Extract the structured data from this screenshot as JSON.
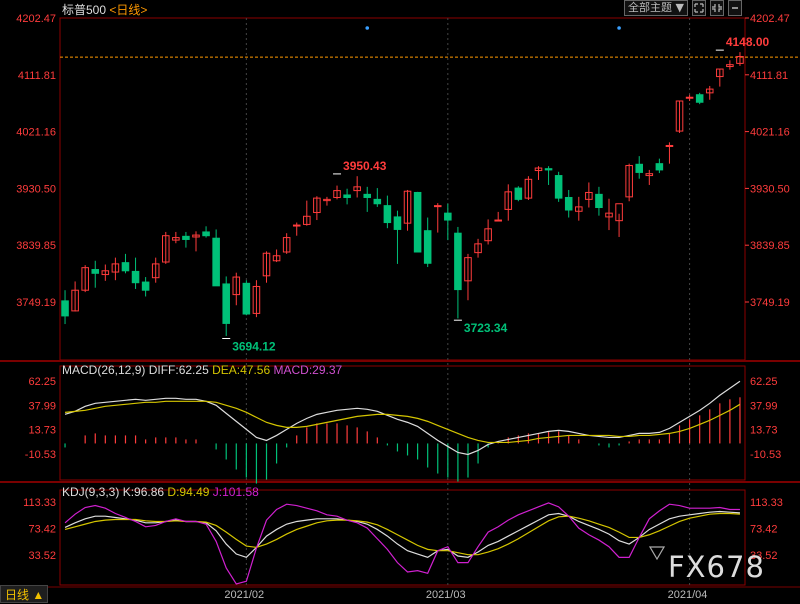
{
  "header": {
    "symbol": "标普500",
    "period_label": "<日线>",
    "theme_label": "全部主题",
    "theme_arrow": "▼",
    "btn_icons": [
      "expand-icon",
      "shrink-icon",
      "minus-icon"
    ]
  },
  "indicators": {
    "macd_name": "MACD(26,12,9)",
    "diff_label": "DIFF:62.25",
    "dea_label": "DEA:47.56",
    "macd_label": "MACD:29.37",
    "kdj_name": "KDJ(9,3,3)",
    "k_label": "K:96.86",
    "d_label": "D:94.49",
    "j_label": "J:101.58"
  },
  "period_button": "日线 ▲",
  "watermark": "FX678",
  "colors": {
    "up": "#ff3c3c",
    "down": "#00c078",
    "axis_price": "#ff3c3c",
    "diff": "#dddddd",
    "dea": "#d4c500",
    "macd_text": "#d050d0",
    "k": "#dddddd",
    "d": "#d4c500",
    "j": "#d020d0",
    "grid": "#8b0000",
    "hline": "#ff9900"
  },
  "chart_data": {
    "type": "candlestick",
    "price_axis": {
      "ticks": [
        "4202.47",
        "4111.81",
        "4021.16",
        "3930.50",
        "3839.85",
        "3749.19"
      ],
      "tick_values": [
        4202.47,
        4111.81,
        4021.16,
        3930.5,
        3839.85,
        3749.19
      ],
      "range": [
        3694.12,
        4202.47
      ]
    },
    "macd_axis": {
      "ticks": [
        "62.25",
        "37.99",
        "13.73",
        "-10.53"
      ],
      "tick_values": [
        62.25,
        37.99,
        13.73,
        -10.53
      ]
    },
    "kdj_axis": {
      "ticks": [
        "113.33",
        "73.42",
        "33.52"
      ],
      "tick_values": [
        113.33,
        73.42,
        33.52
      ]
    },
    "x_labels": [
      "2021/02",
      "2021/03",
      "2021/04"
    ],
    "x_label_bars": [
      18,
      38,
      62
    ],
    "annotations": [
      {
        "text": "3694.12",
        "bar": 16,
        "price": 3694.12,
        "kind": "low"
      },
      {
        "text": "3950.43",
        "bar": 27,
        "price": 3950.43,
        "kind": "high"
      },
      {
        "text": "3723.34",
        "bar": 39,
        "price": 3723.34,
        "kind": "low"
      },
      {
        "text": "4148.00",
        "bar": 65,
        "price": 4148.0,
        "kind": "high"
      }
    ],
    "current_price_line": 4140,
    "ohlc": [
      [
        3751,
        3768,
        3714,
        3727
      ],
      [
        3735,
        3782,
        3734,
        3768
      ],
      [
        3768,
        3808,
        3765,
        3804
      ],
      [
        3801,
        3815,
        3772,
        3795
      ],
      [
        3793,
        3809,
        3783,
        3799
      ],
      [
        3797,
        3820,
        3784,
        3810
      ],
      [
        3812,
        3826,
        3795,
        3799
      ],
      [
        3798,
        3820,
        3770,
        3780
      ],
      [
        3781,
        3789,
        3758,
        3768
      ],
      [
        3788,
        3820,
        3780,
        3810
      ],
      [
        3813,
        3861,
        3810,
        3855
      ],
      [
        3848,
        3861,
        3843,
        3852
      ],
      [
        3854,
        3861,
        3836,
        3849
      ],
      [
        3853,
        3862,
        3830,
        3856
      ],
      [
        3861,
        3870,
        3852,
        3855
      ],
      [
        3851,
        3865,
        3782,
        3775
      ],
      [
        3778,
        3790,
        3695,
        3715
      ],
      [
        3761,
        3796,
        3744,
        3789
      ],
      [
        3779,
        3784,
        3728,
        3730
      ],
      [
        3731,
        3784,
        3725,
        3774
      ],
      [
        3791,
        3830,
        3780,
        3827
      ],
      [
        3815,
        3833,
        3813,
        3823
      ],
      [
        3829,
        3859,
        3826,
        3852
      ],
      [
        3871,
        3876,
        3855,
        3872
      ],
      [
        3873,
        3911,
        3871,
        3886
      ],
      [
        3892,
        3918,
        3880,
        3915
      ],
      [
        3911,
        3917,
        3903,
        3913
      ],
      [
        3916,
        3935,
        3913,
        3927
      ],
      [
        3920,
        3930,
        3905,
        3916
      ],
      [
        3927,
        3950,
        3916,
        3933
      ],
      [
        3921,
        3933,
        3893,
        3916
      ],
      [
        3913,
        3931,
        3901,
        3906
      ],
      [
        3903,
        3919,
        3867,
        3876
      ],
      [
        3885,
        3895,
        3810,
        3865
      ],
      [
        3875,
        3928,
        3863,
        3926
      ],
      [
        3924,
        3925,
        3829,
        3829
      ],
      [
        3863,
        3884,
        3805,
        3811
      ],
      [
        3903,
        3907,
        3860,
        3903
      ],
      [
        3891,
        3906,
        3848,
        3880
      ],
      [
        3859,
        3869,
        3723,
        3769
      ],
      [
        3783,
        3826,
        3752,
        3820
      ],
      [
        3828,
        3850,
        3820,
        3842
      ],
      [
        3847,
        3881,
        3841,
        3866
      ],
      [
        3880,
        3893,
        3878,
        3880
      ],
      [
        3897,
        3937,
        3879,
        3925
      ],
      [
        3931,
        3934,
        3910,
        3913
      ],
      [
        3915,
        3950,
        3912,
        3945
      ],
      [
        3959,
        3966,
        3944,
        3963
      ],
      [
        3962,
        3966,
        3936,
        3960
      ],
      [
        3951,
        3957,
        3909,
        3915
      ],
      [
        3916,
        3928,
        3884,
        3896
      ],
      [
        3894,
        3917,
        3879,
        3901
      ],
      [
        3913,
        3940,
        3900,
        3924
      ],
      [
        3921,
        3933,
        3887,
        3900
      ],
      [
        3885,
        3914,
        3864,
        3891
      ],
      [
        3879,
        3890,
        3853,
        3906
      ],
      [
        3917,
        3970,
        3910,
        3967
      ],
      [
        3969,
        3982,
        3946,
        3956
      ],
      [
        3951,
        3960,
        3936,
        3954
      ],
      [
        3970,
        3978,
        3955,
        3960
      ],
      [
        3998,
        4004,
        3970,
        3999
      ],
      [
        4022,
        4070,
        4019,
        4070
      ],
      [
        4075,
        4080,
        4070,
        4076
      ],
      [
        4080,
        4083,
        4065,
        4068
      ],
      [
        4083,
        4094,
        4072,
        4089
      ],
      [
        4109,
        4121,
        4093,
        4121
      ],
      [
        4125,
        4135,
        4120,
        4128
      ],
      [
        4130,
        4148,
        4126,
        4141
      ]
    ],
    "macd": {
      "diff": [
        29,
        32,
        37,
        40,
        41,
        42,
        43,
        44,
        43,
        44,
        45,
        45,
        44,
        44,
        42,
        38,
        30,
        22,
        14,
        6,
        3,
        8,
        14,
        20,
        25,
        29,
        31,
        33,
        34,
        35,
        34,
        32,
        28,
        24,
        21,
        17,
        10,
        3,
        -3,
        -9,
        -11,
        -7,
        -1,
        2,
        4,
        6,
        8,
        10,
        12,
        13,
        12,
        10,
        8,
        7,
        6,
        6,
        8,
        10,
        10,
        11,
        15,
        21,
        27,
        33,
        40,
        48,
        55,
        62
      ],
      "dea": [
        31,
        32,
        33,
        35,
        37,
        38,
        39,
        40,
        41,
        41,
        42,
        42,
        42,
        42,
        42,
        41,
        38,
        35,
        31,
        26,
        21,
        18,
        16,
        16,
        17,
        19,
        21,
        23,
        25,
        27,
        28,
        29,
        29,
        28,
        27,
        25,
        22,
        18,
        14,
        10,
        6,
        3,
        1,
        1,
        1,
        2,
        3,
        5,
        6,
        7,
        8,
        8,
        8,
        8,
        8,
        7,
        7,
        8,
        8,
        9,
        10,
        12,
        15,
        19,
        23,
        28,
        33,
        39
      ],
      "hist": [
        -4,
        0,
        8,
        10,
        8,
        8,
        8,
        8,
        4,
        6,
        6,
        6,
        4,
        4,
        0,
        -6,
        -16,
        -26,
        -34,
        -40,
        -36,
        -20,
        -4,
        8,
        16,
        20,
        20,
        20,
        18,
        16,
        12,
        6,
        -2,
        -8,
        -12,
        -16,
        -24,
        -30,
        -34,
        -38,
        -34,
        -20,
        -4,
        2,
        6,
        8,
        10,
        10,
        12,
        12,
        8,
        4,
        0,
        -2,
        -4,
        -2,
        2,
        4,
        4,
        4,
        10,
        18,
        24,
        28,
        34,
        40,
        44,
        46
      ]
    },
    "kdj": {
      "k": [
        75,
        82,
        88,
        92,
        92,
        90,
        88,
        86,
        82,
        82,
        84,
        86,
        84,
        84,
        82,
        70,
        50,
        35,
        30,
        45,
        62,
        72,
        80,
        84,
        86,
        88,
        88,
        88,
        86,
        84,
        80,
        72,
        62,
        50,
        40,
        35,
        30,
        40,
        42,
        32,
        30,
        38,
        48,
        54,
        62,
        70,
        78,
        86,
        94,
        96,
        92,
        84,
        78,
        72,
        65,
        55,
        50,
        60,
        72,
        80,
        88,
        92,
        94,
        96,
        98,
        99,
        98,
        97
      ],
      "d": [
        72,
        76,
        80,
        84,
        86,
        87,
        87,
        87,
        85,
        84,
        84,
        85,
        84,
        84,
        83,
        78,
        68,
        57,
        47,
        45,
        50,
        57,
        65,
        72,
        77,
        82,
        85,
        86,
        86,
        85,
        83,
        79,
        72,
        64,
        56,
        48,
        42,
        40,
        40,
        37,
        34,
        34,
        38,
        43,
        50,
        58,
        67,
        76,
        85,
        91,
        92,
        89,
        85,
        80,
        75,
        68,
        60,
        60,
        64,
        70,
        77,
        84,
        89,
        92,
        95,
        96,
        96,
        95
      ],
      "j": [
        82,
        95,
        105,
        108,
        104,
        96,
        90,
        84,
        76,
        78,
        84,
        88,
        84,
        84,
        80,
        54,
        14,
        -10,
        -6,
        44,
        86,
        102,
        110,
        108,
        104,
        100,
        94,
        92,
        86,
        82,
        74,
        58,
        42,
        22,
        8,
        10,
        6,
        40,
        46,
        22,
        22,
        46,
        68,
        76,
        86,
        94,
        100,
        106,
        112,
        106,
        92,
        74,
        64,
        56,
        46,
        30,
        30,
        60,
        88,
        100,
        110,
        108,
        104,
        104,
        104,
        105,
        102,
        102
      ]
    }
  }
}
